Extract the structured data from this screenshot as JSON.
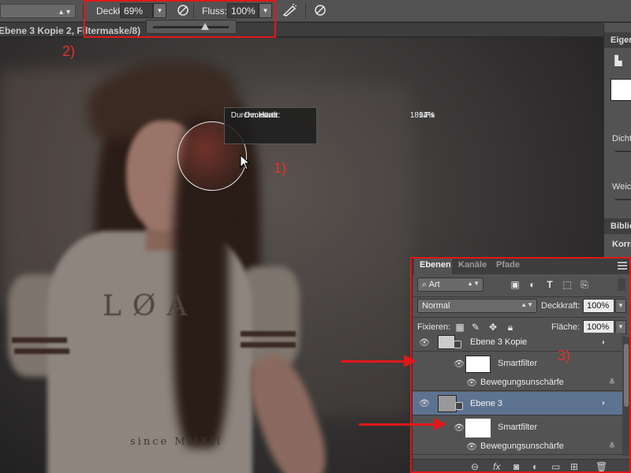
{
  "options_bar": {
    "opacity_label": "Deckkr.:",
    "opacity_value": "69%",
    "flow_label": "Fluss:",
    "flow_value": "100%",
    "flow_slider_fraction": 0.69
  },
  "document_tab": {
    "title": "Ebene 3 Kopie 2, Filtermaske/8)"
  },
  "brush_tooltip": {
    "rows": [
      {
        "label": "Durchmesser:",
        "value": "189 Px"
      },
      {
        "label": "Härte:",
        "value": "2%"
      },
      {
        "label": "Deckkraft:",
        "value": "14%"
      }
    ]
  },
  "annotations": {
    "one": "1)",
    "two": "2)",
    "three": "3)"
  },
  "photo": {
    "shirt_text": "LØA",
    "shirt_text_small": "since MMXII"
  },
  "right_dock": {
    "properties_tab": "Eigen",
    "density_label": "Dicht",
    "feather_label": "Weic",
    "library_tab": "Biblio",
    "corrections_label": "Korre"
  },
  "layers_panel": {
    "tabs": [
      "Ebenen",
      "Kanäle",
      "Pfade"
    ],
    "filter_kind": "Art",
    "blend_mode": "Normal",
    "opacity_label": "Deckkraft:",
    "opacity_value": "100%",
    "lock_label": "Fixieren:",
    "fill_label": "Fläche:",
    "fill_value": "100%",
    "layers": [
      {
        "name": "Ebene 3 Kopie",
        "smart_filter": "Smartfilter",
        "filter": "Bewegungsunschärfe"
      },
      {
        "name": "Ebene 3",
        "smart_filter": "Smartfilter",
        "filter": "Bewegungsunschärfe"
      }
    ]
  },
  "colors": {
    "annotation_red": "#e1171b",
    "selected_layer": "#5e7390",
    "panel_bg": "#535353"
  }
}
